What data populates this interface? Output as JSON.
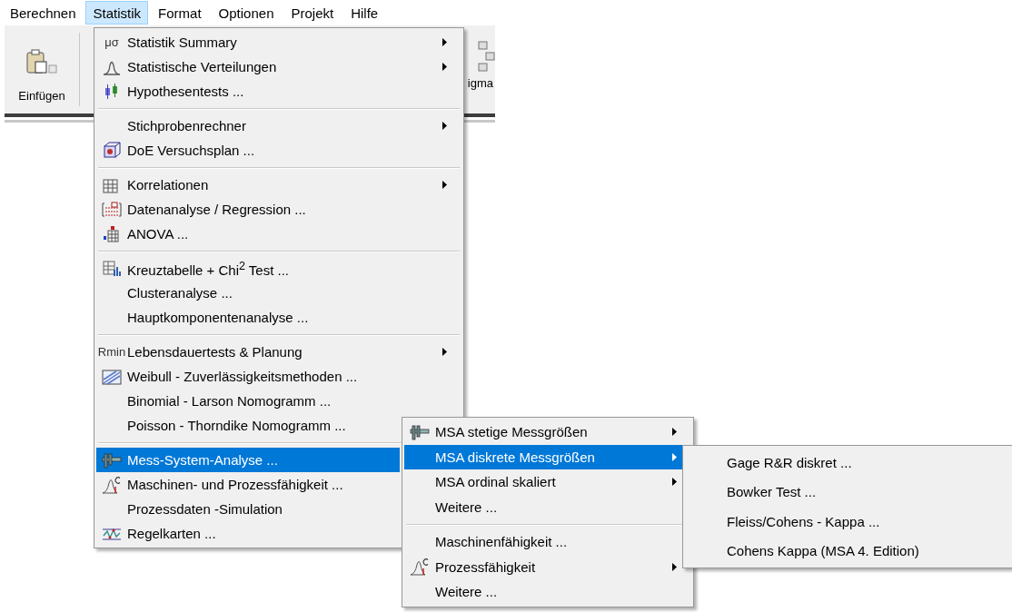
{
  "menubar": [
    {
      "label": "Berechnen",
      "selected": false
    },
    {
      "label": "Statistik",
      "selected": true
    },
    {
      "label": "Format",
      "selected": false
    },
    {
      "label": "Optionen",
      "selected": false
    },
    {
      "label": "Projekt",
      "selected": false
    },
    {
      "label": "Hilfe",
      "selected": false
    }
  ],
  "toolbar": {
    "paste_label": "Einfügen",
    "cut_label": "igma"
  },
  "menus": [
    {
      "items": [
        {
          "kind": "glyph",
          "glyph": "μσ",
          "label": "Statistik Summary",
          "submenu": true,
          "selected": false
        },
        {
          "kind": "bell",
          "label": "Statistische Verteilungen",
          "submenu": true,
          "selected": false
        },
        {
          "kind": "boxplot",
          "label": "Hypothesentests ...",
          "submenu": false,
          "selected": false
        },
        {
          "kind": "separator"
        },
        {
          "kind": "plain",
          "label": "Stichprobenrechner",
          "submenu": true,
          "selected": false
        },
        {
          "kind": "cube",
          "label": "DoE Versuchsplan ...",
          "submenu": false,
          "selected": false
        },
        {
          "kind": "separator"
        },
        {
          "kind": "grid",
          "label": "Korrelationen",
          "submenu": true,
          "selected": false
        },
        {
          "kind": "regression",
          "label": "Datenanalyse / Regression ...",
          "submenu": false,
          "selected": false
        },
        {
          "kind": "anova",
          "label": "ANOVA ...",
          "submenu": false,
          "selected": false
        },
        {
          "kind": "separator"
        },
        {
          "kind": "crosstab",
          "label": "Kreuztabelle + Chi$^{2}$ Test ...",
          "submenu": false,
          "selected": false
        },
        {
          "kind": "plain",
          "label": "Clusteranalyse ...",
          "submenu": false,
          "selected": false
        },
        {
          "kind": "plain",
          "label": "Hauptkomponentenanalyse ...",
          "submenu": false,
          "selected": false
        },
        {
          "kind": "separator"
        },
        {
          "kind": "glyph",
          "glyph": "Rmin",
          "label": "Lebensdauertests & Planung",
          "submenu": true,
          "selected": false
        },
        {
          "kind": "weibull",
          "label": "Weibull - Zuverlässigkeitsmethoden ...",
          "submenu": false,
          "selected": false
        },
        {
          "kind": "plain",
          "label": "Binomial - Larson Nomogramm ...",
          "submenu": false,
          "selected": false
        },
        {
          "kind": "plain",
          "label": "Poisson - Thorndike Nomogramm ...",
          "submenu": false,
          "selected": false
        },
        {
          "kind": "separator"
        },
        {
          "kind": "caliper",
          "label": "Mess-System-Analyse ...",
          "submenu": false,
          "selected": true
        },
        {
          "kind": "capability",
          "label": "Maschinen- und Prozessfähigkeit ...",
          "submenu": false,
          "selected": false
        },
        {
          "kind": "plain",
          "label": "Prozessdaten -Simulation",
          "submenu": false,
          "selected": false
        },
        {
          "kind": "control",
          "label": "Regelkarten ...",
          "submenu": false,
          "selected": false
        }
      ]
    },
    {
      "items": [
        {
          "kind": "caliper",
          "label": "MSA stetige Messgrößen",
          "submenu": true,
          "selected": false
        },
        {
          "kind": "plain",
          "label": "MSA diskrete Messgrößen",
          "submenu": true,
          "selected": true
        },
        {
          "kind": "plain",
          "label": "MSA ordinal skaliert",
          "submenu": true,
          "selected": false
        },
        {
          "kind": "plain",
          "label": "Weitere ...",
          "submenu": false,
          "selected": false
        },
        {
          "kind": "separator"
        },
        {
          "kind": "plain",
          "label": "Maschinenfähigkeit ...",
          "submenu": false,
          "selected": false
        },
        {
          "kind": "capability",
          "label": "Prozessfähigkeit",
          "submenu": true,
          "selected": false
        },
        {
          "kind": "plain",
          "label": "Weitere ...",
          "submenu": false,
          "selected": false
        }
      ]
    },
    {
      "items": [
        {
          "kind": "plain",
          "label": "Gage R&R diskret ...",
          "submenu": false,
          "selected": false
        },
        {
          "kind": "plain",
          "label": "Bowker Test ...",
          "submenu": false,
          "selected": false
        },
        {
          "kind": "plain",
          "label": "Fleiss/Cohens - Kappa  ...",
          "submenu": false,
          "selected": false
        },
        {
          "kind": "plain",
          "label": "Cohens Kappa  (MSA 4. Edition)",
          "submenu": false,
          "selected": false
        }
      ]
    }
  ]
}
